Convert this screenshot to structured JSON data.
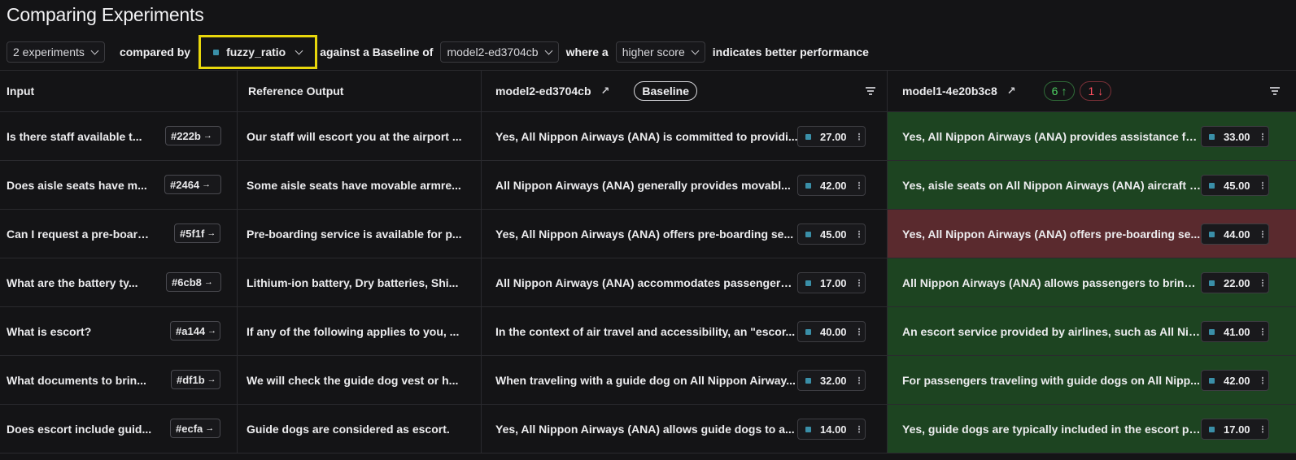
{
  "page": {
    "title": "Comparing Experiments"
  },
  "controls": {
    "experiments_label": "2 experiments",
    "compared_by_text": "compared by",
    "metric_label": "fuzzy_ratio",
    "baseline_text": "against a Baseline of",
    "baseline_label": "model2-ed3704cb",
    "where_text": "where a",
    "direction_label": "higher score",
    "tail_text": "indicates better performance"
  },
  "columns": {
    "input": "Input",
    "reference": "Reference Output",
    "baseline_model": "model2-ed3704cb",
    "baseline_badge": "Baseline",
    "compare_model": "model1-4e20b3c8",
    "improved_count": "6",
    "regressed_count": "1"
  },
  "rows": [
    {
      "input": "Is there staff available t...",
      "id": "#222b",
      "reference": "Our staff will escort you at the airport ...",
      "baseline_output": "Yes, All Nippon Airways (ANA) is committed to providi...",
      "baseline_score": "27.00",
      "compare_output": "Yes, All Nippon Airways (ANA) provides assistance fo...",
      "compare_score": "33.00",
      "status": "improved"
    },
    {
      "input": "Does aisle seats have m...",
      "id": "#2464",
      "reference": "Some aisle seats have movable armre...",
      "baseline_output": "All Nippon Airways (ANA) generally provides movabl...",
      "baseline_score": "42.00",
      "compare_output": "Yes, aisle seats on All Nippon Airways (ANA) aircraft t...",
      "compare_score": "45.00",
      "status": "improved"
    },
    {
      "input": "Can I request a pre-board...",
      "id": "#5f1f",
      "reference": "Pre-boarding service is available for p...",
      "baseline_output": "Yes, All Nippon Airways (ANA) offers pre-boarding se...",
      "baseline_score": "45.00",
      "compare_output": "Yes, All Nippon Airways (ANA) offers pre-boarding se...",
      "compare_score": "44.00",
      "status": "regressed"
    },
    {
      "input": "What are the battery ty...",
      "id": "#6cb8",
      "reference": "Lithium-ion battery, Dry batteries, Shi...",
      "baseline_output": "All Nippon Airways (ANA) accommodates passengers ...",
      "baseline_score": "17.00",
      "compare_output": "All Nippon Airways (ANA) allows passengers to bring ...",
      "compare_score": "22.00",
      "status": "improved"
    },
    {
      "input": "What is escort?",
      "id": "#a144",
      "reference": "If any of the following applies to you, ...",
      "baseline_output": "In the context of air travel and accessibility, an \"escor...",
      "baseline_score": "40.00",
      "compare_output": "An escort service provided by airlines, such as All Nip...",
      "compare_score": "41.00",
      "status": "improved"
    },
    {
      "input": "What documents to brin...",
      "id": "#df1b",
      "reference": "We will check the guide dog vest or h...",
      "baseline_output": "When traveling with a guide dog on All Nippon Airway...",
      "baseline_score": "32.00",
      "compare_output": "For passengers traveling with guide dogs on All Nipp...",
      "compare_score": "42.00",
      "status": "improved"
    },
    {
      "input": "Does escort include guid...",
      "id": "#ecfa",
      "reference": "Guide dogs are considered as escort.",
      "baseline_output": "Yes, All Nippon Airways (ANA) allows guide dogs to a...",
      "baseline_score": "14.00",
      "compare_output": "Yes, guide dogs are typically included in the escort po...",
      "compare_score": "17.00",
      "status": "improved"
    }
  ],
  "icons": {
    "chevron": "chevron-down-icon",
    "external": "external-link-icon",
    "filter": "filter-icon",
    "arrow_up": "arrow-up-icon",
    "arrow_down": "arrow-down-icon",
    "arrow_right": "arrow-right-icon",
    "more": "more-vertical-icon"
  },
  "colors": {
    "improved_bg": "#1d4421",
    "regressed_bg": "#5a2a2e",
    "highlight": "#e8d70c",
    "metric_dot": "#3a8fa8"
  }
}
